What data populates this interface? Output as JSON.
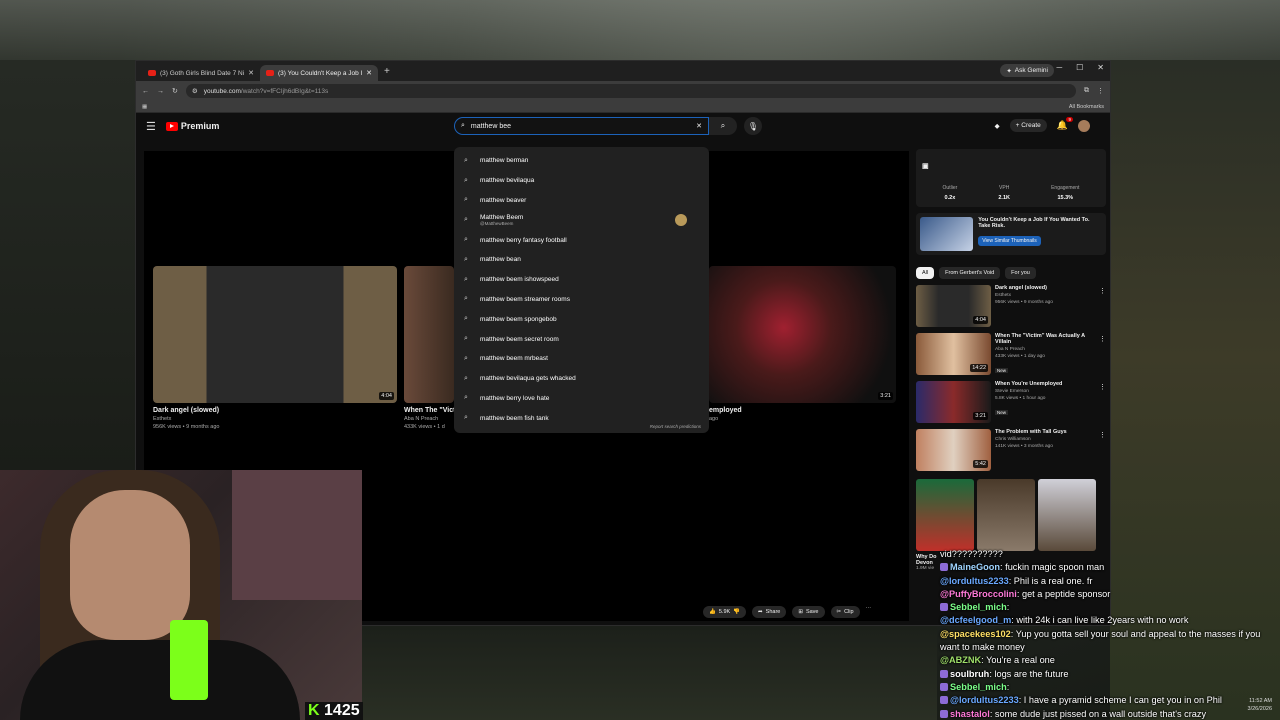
{
  "browser": {
    "tabs": [
      {
        "title": "(3) Goth Girls Blind Date 7 Nice"
      },
      {
        "title": "(3) You Couldn't Keep a Job If Y"
      }
    ],
    "ask_gemini": "Ask Gemini",
    "url_host": "youtube.com",
    "url_path": "/watch?v=fFCIjh6dBIg&t=113s",
    "bookmarks_label": "All Bookmarks"
  },
  "youtube": {
    "logo_text": "Premium",
    "search_value": "matthew bee",
    "create_label": "Create",
    "notif_count": "9",
    "suggestions": [
      {
        "text": "matthew berman"
      },
      {
        "text": "matthew bevilaqua"
      },
      {
        "text": "matthew beaver"
      },
      {
        "text": "Matthew Beem",
        "sub": "@MatthewBeem"
      },
      {
        "text": "matthew berry fantasy football"
      },
      {
        "text": "matthew bean"
      },
      {
        "text": "matthew beem ishowspeed"
      },
      {
        "text": "matthew beem streamer rooms"
      },
      {
        "text": "matthew beem spongebob"
      },
      {
        "text": "matthew beem secret room"
      },
      {
        "text": "matthew beem mrbeast"
      },
      {
        "text": "matthew bevilaqua gets whacked"
      },
      {
        "text": "matthew berry love hate"
      },
      {
        "text": "matthew beem fish tank"
      }
    ],
    "report_label": "Report search predictions",
    "grid": [
      {
        "title": "Dark angel (slowed)",
        "channel": "Esthetx",
        "meta": "956K views • 9 months ago",
        "duration": "4:04"
      },
      {
        "title": "When The \"Vict",
        "channel": "Aba N Preach",
        "meta": "433K views • 1 d"
      },
      {
        "title": "employed",
        "meta": "ago",
        "duration": "3:21"
      }
    ],
    "actions": {
      "likes": "5.9K",
      "share": "Share",
      "save": "Save",
      "clip": "Clip"
    },
    "ext": {
      "outlier_label": "Outlier",
      "outlier": "0.2x",
      "vph_label": "VPH",
      "vph": "2.1K",
      "eng_label": "Engagement",
      "eng": "15.3%"
    },
    "promo": {
      "title": "You Couldn't Keep a Job If You Wanted To. Take Risk.",
      "button": "View Similar Thumbnails"
    },
    "chips": [
      "All",
      "From Gerbert's Void",
      "For you"
    ],
    "recs": [
      {
        "title": "Dark angel (slowed)",
        "channel": "Esthetx",
        "meta": "956K views • 9 months ago",
        "duration": "4:04",
        "new": ""
      },
      {
        "title": "When The \"Victim\" Was Actually A Villain",
        "channel": "Aba N Preach",
        "meta": "433K views • 1 day ago",
        "duration": "14:22",
        "new": "New"
      },
      {
        "title": "When You're Unemployed",
        "channel": "Stevie Emerson",
        "meta": "5.8K views • 1 hour ago",
        "duration": "3:21",
        "new": "New"
      },
      {
        "title": "The Problem with Tall Guys",
        "channel": "Chris Williamson",
        "meta": "141K views • 3 months ago",
        "duration": "5:42",
        "new": ""
      }
    ],
    "shorts_caption": "Why Do",
    "shorts_caption2": "Devon",
    "shorts_views": "1.9M vie"
  },
  "stream": {
    "counter": "1425",
    "counter_icon": "K"
  },
  "chat": [
    {
      "user": "",
      "msg": "vid??????????"
    },
    {
      "user": "MaineGoon",
      "msg": ": fuckin magic spoon man"
    },
    {
      "user": "@lordultus2233",
      "msg": ": Phil is a real one. fr"
    },
    {
      "user": "@PuffyBroccolini",
      "msg": ": get a peptide sponsor"
    },
    {
      "user": "Sebbel_mich",
      "msg": ":"
    },
    {
      "user": "@dcfeelgood_m",
      "msg": ": with 24k i can live like 2years with no work"
    },
    {
      "user": "@spacekees102",
      "msg": ": Yup you gotta sell your soul and appeal to the masses if you want to make money"
    },
    {
      "user": "@ABZNK",
      "msg": ": You're a real one"
    },
    {
      "user": "soulbruh",
      "msg": ": logs are the future"
    },
    {
      "user": "Sebbel_mich",
      "msg": ":"
    },
    {
      "user": "@lordultus2233",
      "msg": ": I have a pyramid scheme I can get you in on Phil"
    },
    {
      "user": "shastalol",
      "msg": ": some dude just pissed on a wall outside that's crazy"
    }
  ],
  "clock": {
    "time": "11:52 AM",
    "date": "3/26/2026"
  },
  "colors": {
    "accent": "#1c62b9",
    "yt_red": "#ff0000",
    "can_green": "#7cff1a"
  }
}
